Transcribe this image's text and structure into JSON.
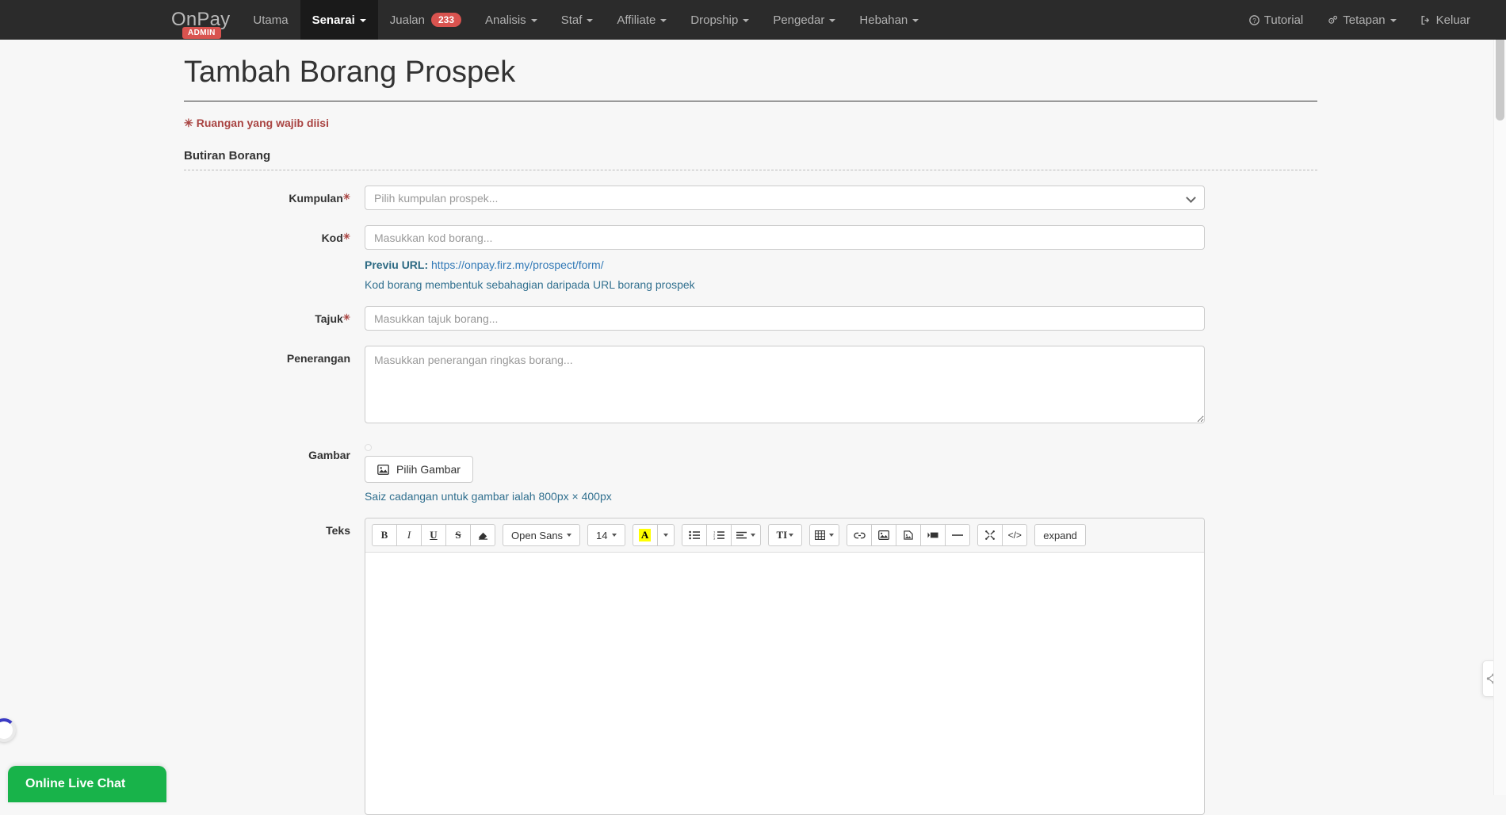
{
  "navbar": {
    "brand": "OnPay",
    "brand_badge": "ADMIN",
    "accent_red": "#d9534f",
    "bg": "#2b2b2b",
    "left_items": [
      {
        "label": "Utama",
        "caret": false,
        "active": false,
        "badge": null
      },
      {
        "label": "Senarai",
        "caret": true,
        "active": true,
        "badge": null
      },
      {
        "label": "Jualan",
        "caret": false,
        "active": false,
        "badge": "233"
      },
      {
        "label": "Analisis",
        "caret": true,
        "active": false,
        "badge": null
      },
      {
        "label": "Staf",
        "caret": true,
        "active": false,
        "badge": null
      },
      {
        "label": "Affiliate",
        "caret": true,
        "active": false,
        "badge": null
      },
      {
        "label": "Dropship",
        "caret": true,
        "active": false,
        "badge": null
      },
      {
        "label": "Pengedar",
        "caret": true,
        "active": false,
        "badge": null
      },
      {
        "label": "Hebahan",
        "caret": true,
        "active": false,
        "badge": null
      }
    ],
    "right_items": [
      {
        "label": "Tutorial",
        "icon": "question-circle-icon",
        "caret": false
      },
      {
        "label": "Tetapan",
        "icon": "gear-icon",
        "caret": true
      },
      {
        "label": "Keluar",
        "icon": "sign-out-icon",
        "caret": false
      }
    ]
  },
  "page": {
    "title": "Tambah Borang Prospek",
    "required_note": "Ruangan yang wajib diisi",
    "required_star": "✳",
    "section_title": "Butiran Borang"
  },
  "form": {
    "kumpulan": {
      "label": "Kumpulan",
      "required": true,
      "placeholder": "Pilih kumpulan prospek...",
      "value": "",
      "options": [
        "Pilih kumpulan prospek..."
      ]
    },
    "kod": {
      "label": "Kod",
      "required": true,
      "placeholder": "Masukkan kod borang...",
      "value": "",
      "preview_label": "Previu URL:",
      "preview_url": "https://onpay.firz.my/prospect/form/",
      "help": "Kod borang membentuk sebahagian daripada URL borang prospek"
    },
    "tajuk": {
      "label": "Tajuk",
      "required": true,
      "placeholder": "Masukkan tajuk borang...",
      "value": ""
    },
    "penerangan": {
      "label": "Penerangan",
      "required": false,
      "placeholder": "Masukkan penerangan ringkas borang...",
      "value": ""
    },
    "gambar": {
      "label": "Gambar",
      "button": "Pilih Gambar",
      "button_icon": "image-icon",
      "help": "Saiz cadangan untuk gambar ialah 800px × 400px"
    },
    "teks": {
      "label": "Teks",
      "content": ""
    }
  },
  "editor_toolbar": {
    "groups": [
      {
        "name": "style-group",
        "buttons": [
          {
            "name": "bold-button",
            "glyph": "B",
            "style": "bold",
            "caret": false
          },
          {
            "name": "italic-button",
            "glyph": "I",
            "style": "italic",
            "caret": false
          },
          {
            "name": "underline-button",
            "glyph": "U",
            "style": "underline",
            "caret": false
          },
          {
            "name": "strikethrough-button",
            "glyph": "S",
            "style": "strike",
            "caret": false
          },
          {
            "name": "remove-format-button",
            "glyph": "▰",
            "style": "plain",
            "caret": false
          }
        ]
      },
      {
        "name": "font-family-group",
        "buttons": [
          {
            "name": "font-name-dropdown",
            "glyph": "Open Sans",
            "style": "wide",
            "caret": true
          }
        ]
      },
      {
        "name": "font-size-group",
        "buttons": [
          {
            "name": "font-size-dropdown",
            "glyph": "14",
            "style": "wide",
            "caret": true
          }
        ]
      },
      {
        "name": "color-group",
        "buttons": [
          {
            "name": "text-highlight-button",
            "glyph": "A",
            "style": "highlight",
            "caret": false
          },
          {
            "name": "color-dropdown",
            "glyph": "",
            "style": "caretonly",
            "caret": true
          }
        ]
      },
      {
        "name": "list-group",
        "buttons": [
          {
            "name": "unordered-list-button",
            "glyph": "ul",
            "style": "svg",
            "caret": false
          },
          {
            "name": "ordered-list-button",
            "glyph": "ol",
            "style": "svg",
            "caret": false
          },
          {
            "name": "paragraph-align-dropdown",
            "glyph": "align",
            "style": "svg",
            "caret": true
          }
        ]
      },
      {
        "name": "style-tag-group",
        "buttons": [
          {
            "name": "paragraph-style-dropdown",
            "glyph": "TI",
            "style": "wide",
            "caret": true
          }
        ]
      },
      {
        "name": "table-group",
        "buttons": [
          {
            "name": "insert-table-dropdown",
            "glyph": "table",
            "style": "svg",
            "caret": true
          }
        ]
      },
      {
        "name": "insert-group",
        "buttons": [
          {
            "name": "insert-link-button",
            "glyph": "link",
            "style": "svg",
            "caret": false
          },
          {
            "name": "insert-picture-button",
            "glyph": "image",
            "style": "svg",
            "caret": false
          },
          {
            "name": "insert-file-button",
            "glyph": "file",
            "style": "svg",
            "caret": false
          },
          {
            "name": "insert-video-button",
            "glyph": "video",
            "style": "svg",
            "caret": false
          },
          {
            "name": "horizontal-rule-button",
            "glyph": "hr",
            "style": "svg",
            "caret": false
          }
        ]
      },
      {
        "name": "view-group",
        "buttons": [
          {
            "name": "fullscreen-button",
            "glyph": "expand",
            "style": "svg",
            "caret": false
          },
          {
            "name": "code-view-button",
            "glyph": "code",
            "style": "svg",
            "caret": false
          }
        ]
      },
      {
        "name": "help-group",
        "buttons": [
          {
            "name": "help-button",
            "glyph": "?",
            "style": "wide",
            "caret": false
          }
        ]
      }
    ]
  },
  "widgets": {
    "live_chat_label": "Online Live Chat",
    "live_chat_color": "#18b34a",
    "spinner_color": "#3b3bc4"
  }
}
